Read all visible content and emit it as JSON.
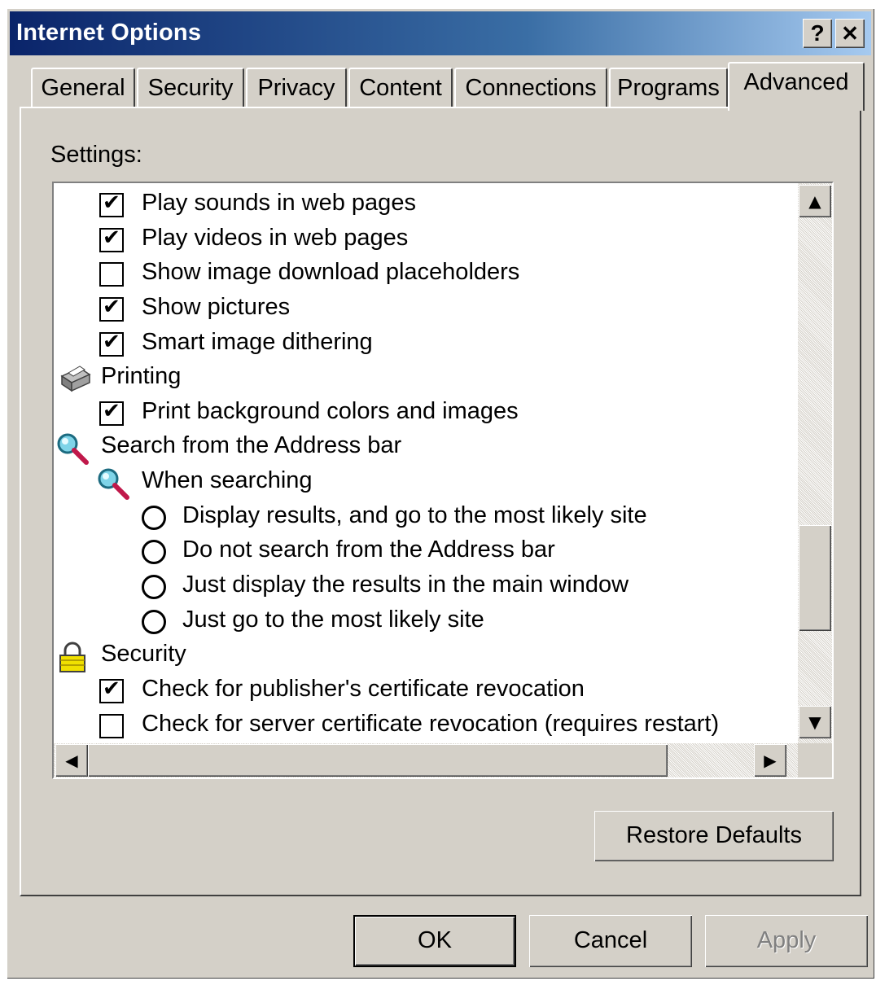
{
  "window": {
    "title": "Internet Options",
    "help_glyph": "?",
    "close_glyph": "✕"
  },
  "tabs": [
    {
      "label": "General"
    },
    {
      "label": "Security"
    },
    {
      "label": "Privacy"
    },
    {
      "label": "Content"
    },
    {
      "label": "Connections"
    },
    {
      "label": "Programs"
    },
    {
      "label": "Advanced",
      "active": true
    }
  ],
  "settings_label": "Settings:",
  "items": [
    {
      "kind": "checkbox",
      "checked": true,
      "label": "Play sounds in web pages"
    },
    {
      "kind": "checkbox",
      "checked": true,
      "label": "Play videos in web pages"
    },
    {
      "kind": "checkbox",
      "checked": false,
      "label": "Show image download placeholders"
    },
    {
      "kind": "checkbox",
      "checked": true,
      "label": "Show pictures"
    },
    {
      "kind": "checkbox",
      "checked": true,
      "label": "Smart image dithering"
    },
    {
      "kind": "category",
      "icon": "printer-icon",
      "label": "Printing"
    },
    {
      "kind": "checkbox",
      "checked": true,
      "label": "Print background colors and images"
    },
    {
      "kind": "category",
      "icon": "magnifier-icon",
      "label": "Search from the Address bar"
    },
    {
      "kind": "subcategory",
      "icon": "magnifier-icon",
      "label": "When searching"
    },
    {
      "kind": "radio",
      "label": "Display results, and go to the most likely site"
    },
    {
      "kind": "radio",
      "label": "Do not search from the Address bar"
    },
    {
      "kind": "radio",
      "label": "Just display the results in the main window"
    },
    {
      "kind": "radio",
      "label": "Just go to the most likely site"
    },
    {
      "kind": "category",
      "icon": "lock-icon",
      "label": "Security"
    },
    {
      "kind": "checkbox",
      "checked": true,
      "label": "Check for publisher's certificate revocation"
    },
    {
      "kind": "checkbox",
      "checked": false,
      "label": "Check for server certificate revocation (requires restart)"
    }
  ],
  "buttons": {
    "restore_defaults": "Restore Defaults",
    "ok": "OK",
    "cancel": "Cancel",
    "apply": "Apply"
  },
  "scroll_glyphs": {
    "up": "▲",
    "down": "▼",
    "left": "◀",
    "right": "▶"
  },
  "colors": {
    "title_gradient_start": "#0a246a",
    "title_gradient_end": "#a6caf0",
    "face": "#d4d0c8"
  }
}
